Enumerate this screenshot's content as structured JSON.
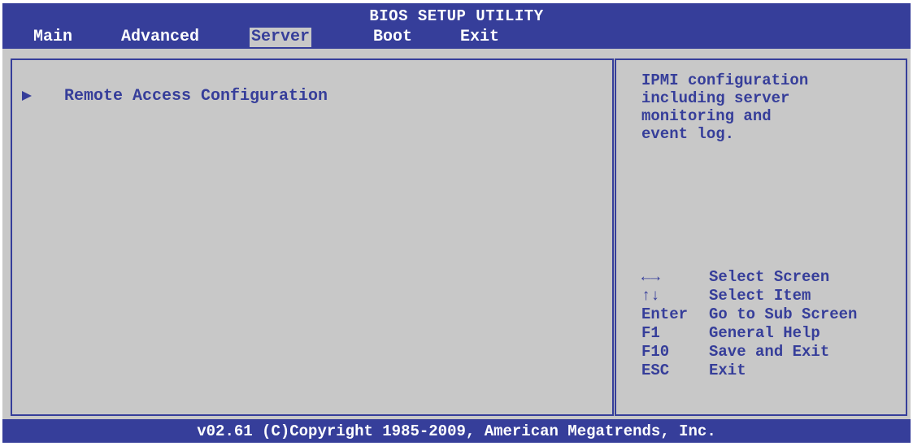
{
  "app": {
    "title": "BIOS SETUP UTILITY"
  },
  "tabs": [
    {
      "label": "Main",
      "active": false
    },
    {
      "label": "Advanced",
      "active": false
    },
    {
      "label": "Server",
      "active": true
    },
    {
      "label": "Boot",
      "active": false
    },
    {
      "label": "Exit",
      "active": false
    }
  ],
  "menu": {
    "items": [
      {
        "label": "Remote Access Configuration",
        "icon": "submenu-arrow-icon"
      }
    ]
  },
  "help": {
    "lines": [
      "IPMI configuration",
      "including server",
      "monitoring and",
      "event log."
    ]
  },
  "keys": [
    {
      "key": "←→",
      "action": "Select Screen"
    },
    {
      "key": "↑↓",
      "action": "Select Item"
    },
    {
      "key": "Enter",
      "action": "Go to Sub Screen"
    },
    {
      "key": "F1",
      "action": "General Help"
    },
    {
      "key": "F10",
      "action": "Save and Exit"
    },
    {
      "key": "ESC",
      "action": "Exit"
    }
  ],
  "footer": {
    "text": "v02.61 (C)Copyright 1985-2009, American Megatrends, Inc."
  },
  "colors": {
    "header_bg": "#363e9a",
    "panel_bg": "#c8c8c8",
    "text": "#363e9a"
  }
}
